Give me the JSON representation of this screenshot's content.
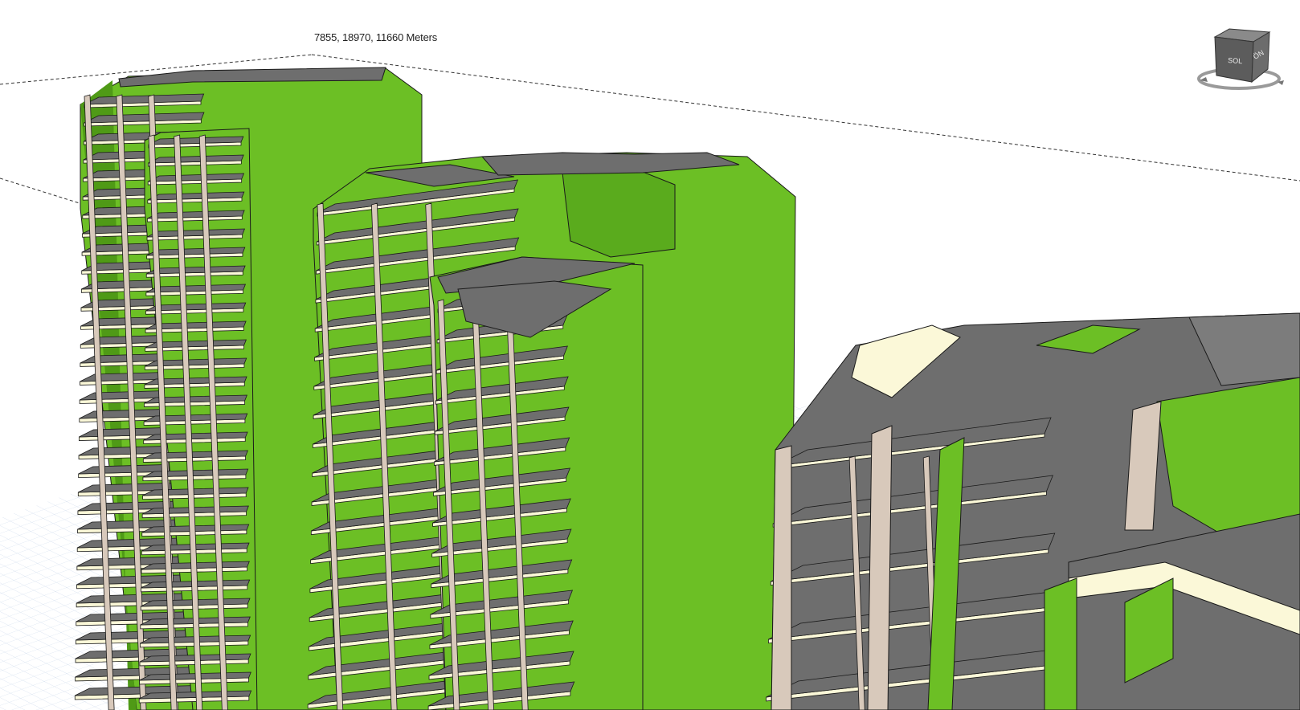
{
  "viewport": {
    "coordinate_readout": "7855, 18970, 11660 Meters",
    "background_color": "#ffffff",
    "grid_color": "#c9d7ea"
  },
  "viewcube": {
    "icon": "view-cube-icon",
    "left_face_label": "SOL",
    "right_face_label": "ÖN"
  },
  "colors": {
    "wall": "#6cbf25",
    "wall_dark": "#4f9a16",
    "slab_top": "#6e6e6e",
    "slab_edge": "#fbf8d8",
    "column": "#d8c9bb",
    "outline": "#1a1a1a"
  }
}
